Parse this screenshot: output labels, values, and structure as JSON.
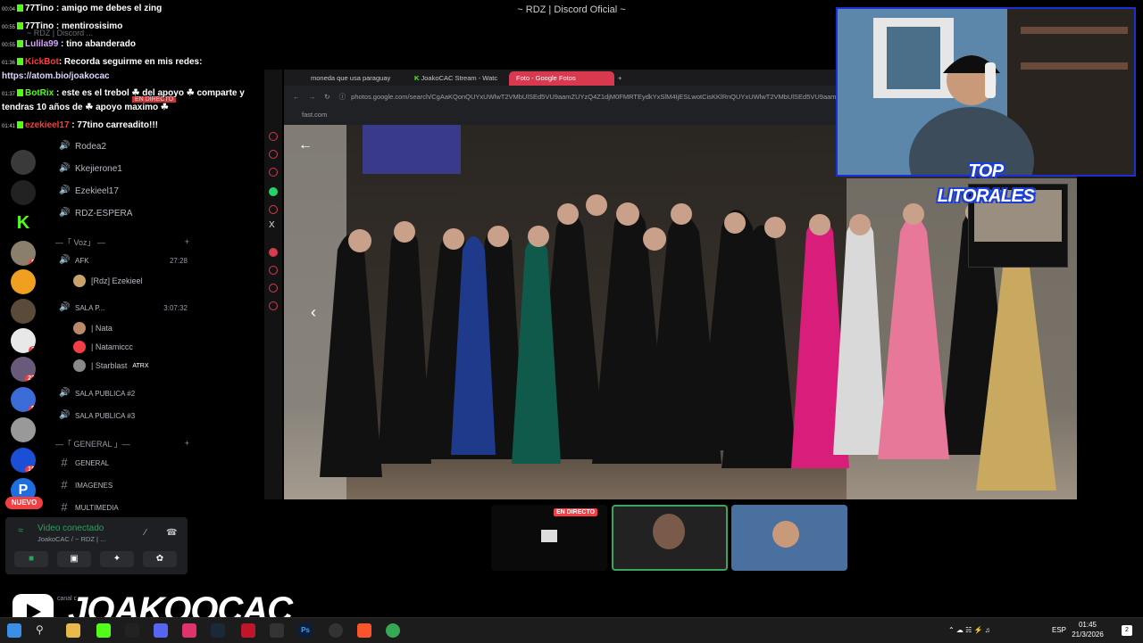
{
  "window": {
    "title": "~ RDZ | Discord Oficial ~"
  },
  "chat": [
    {
      "time": "00:04",
      "user": "77Tino",
      "user_color": "#ffffff",
      "text": ": amigo me debes el zing"
    },
    {
      "time": "00:55",
      "user": "77Tino",
      "user_color": "#ffffff",
      "text": ": mentirosisimo"
    },
    {
      "time": "00:55",
      "user": "Lulila99",
      "user_color": "#d9a3ff",
      "text": ": tino abanderado"
    },
    {
      "time": "01:36",
      "user": "KickBot",
      "user_color": "#ff3b3b",
      "text": ": Recorda seguirme en mis redes:"
    },
    {
      "time": "",
      "user": "",
      "user_color": "#ffffff",
      "text": "https://atom.bio/joakocac"
    },
    {
      "time": "01:37",
      "user": "BotRix",
      "user_color": "#53fc18",
      "text": ": este es el trebol ☘ del apoyo ☘ comparte y"
    },
    {
      "time": "",
      "user": "",
      "user_color": "#ffffff",
      "text": "tendras 10 años de ☘ apoyo maximo ☘"
    },
    {
      "time": "01:41",
      "user": "ezekieel17",
      "user_color": "#ff3b3b",
      "text": ": 77tino carreadito!!!"
    }
  ],
  "chat_behind": {
    "server_name": "~ RDZ | Discord ...",
    "live_badge": "EN DIRECTO"
  },
  "servers": {
    "badges": [
      "8",
      "3",
      "23",
      "5",
      "18"
    ],
    "new_label": "NUEVO"
  },
  "channels": {
    "voice_top": [
      "Rodea2",
      "Kkejierone1",
      "Ezekieel17",
      "RDZ-ESPERA"
    ],
    "voz_category": "—「 Voz」 —",
    "afk": {
      "name": "AFK",
      "timer": "27:28",
      "users": [
        "[Rdz] Ezekieel"
      ]
    },
    "sala": {
      "name": "SALA P...",
      "timer": "3:07:32",
      "users": [
        "| Nata",
        "| Natamiccc",
        "| Starblast"
      ],
      "tag": "ATRX"
    },
    "public": [
      "SALA PUBLICA #2",
      "SALA PUBLICA #3"
    ],
    "general_category": "—「 GENERAL 」—",
    "text": [
      "GENERAL",
      "IMAGENES",
      "MULTIMEDIA"
    ]
  },
  "voice_panel": {
    "status": "Video conectado",
    "sub": "JoakoCAC / ~ RDZ | ...",
    "hidden_label": "canal d..."
  },
  "browser": {
    "tabs": [
      "moneda que usa paraguay",
      "JoakoCAC Stream - Watc",
      "Foto - Google Fotos"
    ],
    "url": "photos.google.com/search/CgAaKQonQUYxUWlwT2VMbUlSEd5VU9aamZUYzQ4Z1djM0FMRTEydkYxSlM4IjESLwotCisKKlRnQUYxUWlwT2VMbUlSEd5VU9aamZUYzQ4Z1djM0FMRTEydkYxSIM4",
    "bookmark": "fast.com"
  },
  "webcam": {
    "overlay_text": "TOP LITORALES"
  },
  "stream_tiles": {
    "live_badge": "EN DIRECTO"
  },
  "brand": {
    "name": "JOAKOOCAC"
  },
  "taskbar": {
    "lang": "ESP",
    "time": "01:45",
    "date": "21/3/2026",
    "notif": "2"
  },
  "colors": {
    "accent": "#5865f2",
    "live": "#f23f43",
    "green": "#23a55a",
    "cam_border": "#1b2fd6"
  }
}
